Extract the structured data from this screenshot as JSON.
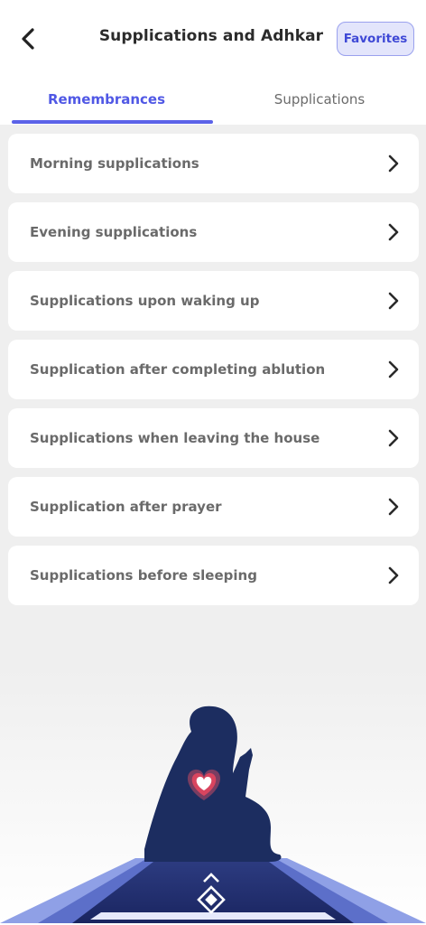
{
  "header": {
    "title": "Supplications and Adhkar",
    "favorites_label": "Favorites"
  },
  "tabs": [
    {
      "label": "Remembrances",
      "active": true
    },
    {
      "label": "Supplications",
      "active": false
    }
  ],
  "items": [
    {
      "label": "Morning supplications"
    },
    {
      "label": "Evening supplications"
    },
    {
      "label": "Supplications upon waking up"
    },
    {
      "label": "Supplication after completing ablution"
    },
    {
      "label": "Supplications when leaving the house"
    },
    {
      "label": "Supplication after prayer"
    },
    {
      "label": "Supplications before sleeping"
    }
  ],
  "icons": {
    "back": "chevron-left-icon",
    "item_arrow": "chevron-right-icon",
    "heart": "heart-icon",
    "logo": "diamond-logo-icon"
  },
  "colors": {
    "accent": "#5058e5",
    "favorites_bg": "#e3e5fb",
    "silhouette": "#1a2a5c",
    "heart": "#d9455f"
  }
}
